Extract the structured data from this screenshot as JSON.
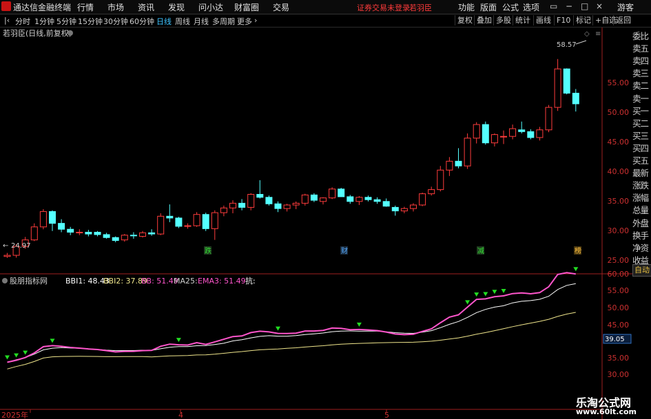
{
  "menubar": {
    "app_name": "通达信金融终端",
    "menus": [
      "行情",
      "市场",
      "资讯",
      "发现",
      "问小达",
      "财富圈",
      "交易"
    ],
    "notice": "证券交易未登录",
    "stock_name": "若羽臣",
    "right_menus": [
      "功能",
      "版面",
      "公式",
      "选项"
    ],
    "guest": "游客"
  },
  "periodbar": {
    "periods": [
      "分时",
      "1分钟",
      "5分钟",
      "15分钟",
      "30分钟",
      "60分钟",
      "日线",
      "周线",
      "月线",
      "多周期",
      "更多"
    ],
    "active": "日线",
    "tools": [
      "复权",
      "叠加",
      "多股",
      "统计",
      "画线",
      "F10",
      "标记",
      "+自选",
      "返回"
    ]
  },
  "main_chart": {
    "title": "若羽臣(日线,前复权)",
    "high_label": "58.57",
    "low_label": "24.97",
    "y_ticks": [
      "55.00",
      "50.00",
      "45.00",
      "40.00",
      "35.00",
      "30.00",
      "25.00"
    ],
    "markers": [
      "跌",
      "财",
      "减",
      "榜"
    ]
  },
  "indicator": {
    "name": "股朋指标网",
    "items": [
      {
        "label": "BBI1: 48.43",
        "color": "#ffffff"
      },
      {
        "label": "BBI2: 37.89",
        "color": "#f0e68c"
      },
      {
        "label": "BB: 51.49",
        "color": "#ff55cc"
      },
      {
        "label": "MA25:",
        "color": "#cfcfcf"
      },
      {
        "label": "EMA3: 51.49",
        "color": "#ff55cc"
      },
      {
        "label": "抗:",
        "color": "#ffffff"
      }
    ],
    "y_ticks": [
      "60.00",
      "55.00",
      "50.00",
      "45.00",
      "35.00",
      "30.00"
    ],
    "current_value": "39.05"
  },
  "x_axis": [
    "2025年",
    "4",
    "5"
  ],
  "right_panel": [
    "委比",
    "卖五",
    "卖四",
    "卖三",
    "卖二",
    "卖一",
    "买一",
    "买二",
    "买三",
    "买四",
    "买五",
    "最新",
    "涨跌",
    "涨幅",
    "总量",
    "外盘",
    "换手",
    "净资",
    "收益"
  ],
  "auto_button": "自动",
  "watermark": {
    "line1": "乐淘公式网",
    "line2": "www.60lt.com"
  },
  "colors": {
    "up": "#ff3c3c",
    "down": "#54ffff",
    "bb": "#ff55cc",
    "bbi1": "#ffffff",
    "bbi2": "#f0e68c",
    "arrow": "#22dd22"
  },
  "chart_data": {
    "type": "candlestick",
    "candles": [
      [
        25.2,
        25.8,
        24.97,
        25.4
      ],
      [
        25.4,
        27.3,
        25.0,
        26.9
      ],
      [
        26.9,
        28.5,
        26.5,
        28.0
      ],
      [
        28.0,
        30.8,
        27.8,
        30.2
      ],
      [
        30.2,
        33.2,
        29.8,
        32.8
      ],
      [
        32.8,
        33.0,
        29.5,
        30.8
      ],
      [
        30.8,
        31.5,
        29.3,
        29.8
      ],
      [
        29.8,
        30.2,
        28.8,
        29.3
      ],
      [
        29.3,
        29.8,
        28.8,
        29.3
      ],
      [
        29.3,
        29.7,
        28.6,
        29.0
      ],
      [
        29.3,
        29.5,
        28.6,
        28.9
      ],
      [
        28.9,
        29.2,
        28.2,
        28.4
      ],
      [
        28.4,
        28.6,
        27.6,
        27.9
      ],
      [
        28.0,
        29.0,
        27.7,
        28.8
      ],
      [
        28.8,
        29.3,
        28.2,
        28.7
      ],
      [
        28.6,
        29.5,
        28.4,
        29.2
      ],
      [
        29.2,
        29.8,
        28.7,
        29.0
      ],
      [
        29.0,
        32.5,
        28.8,
        32.0
      ],
      [
        32.0,
        34.0,
        31.0,
        31.7
      ],
      [
        31.7,
        31.9,
        30.0,
        30.3
      ],
      [
        30.3,
        30.8,
        29.9,
        30.4
      ],
      [
        30.4,
        32.7,
        30.2,
        32.3
      ],
      [
        32.3,
        32.6,
        29.5,
        29.9
      ],
      [
        29.9,
        33.0,
        28.0,
        32.6
      ],
      [
        32.6,
        33.8,
        32.0,
        33.4
      ],
      [
        33.4,
        34.7,
        32.5,
        34.2
      ],
      [
        34.2,
        34.9,
        33.0,
        33.5
      ],
      [
        33.5,
        35.9,
        33.0,
        35.7
      ],
      [
        35.7,
        38.1,
        35.0,
        35.2
      ],
      [
        35.2,
        35.5,
        33.8,
        34.1
      ],
      [
        34.1,
        34.5,
        32.7,
        33.3
      ],
      [
        33.3,
        34.1,
        32.8,
        33.9
      ],
      [
        33.9,
        34.5,
        33.2,
        34.2
      ],
      [
        34.2,
        35.8,
        33.8,
        35.6
      ],
      [
        35.6,
        35.9,
        34.4,
        34.7
      ],
      [
        34.5,
        35.2,
        34.0,
        35.1
      ],
      [
        35.1,
        36.9,
        34.9,
        36.6
      ],
      [
        36.6,
        36.8,
        35.3,
        35.3
      ],
      [
        35.3,
        35.6,
        34.1,
        34.5
      ],
      [
        34.5,
        35.4,
        33.9,
        35.2
      ],
      [
        35.2,
        35.5,
        34.5,
        34.8
      ],
      [
        34.8,
        35.2,
        34.1,
        34.5
      ],
      [
        34.5,
        35.0,
        33.6,
        33.7
      ],
      [
        33.5,
        33.8,
        32.1,
        32.9
      ],
      [
        32.9,
        33.6,
        32.5,
        33.3
      ],
      [
        33.3,
        34.2,
        32.8,
        33.9
      ],
      [
        33.9,
        36.0,
        33.7,
        35.8
      ],
      [
        35.8,
        37.0,
        35.5,
        36.5
      ],
      [
        36.5,
        40.5,
        36.2,
        39.8
      ],
      [
        39.8,
        42.0,
        38.8,
        41.3
      ],
      [
        41.3,
        43.5,
        40.1,
        40.5
      ],
      [
        40.5,
        46.0,
        40.0,
        45.2
      ],
      [
        45.2,
        47.9,
        44.3,
        47.5
      ],
      [
        47.5,
        48.0,
        44.1,
        44.4
      ],
      [
        44.4,
        46.0,
        43.8,
        45.8
      ],
      [
        45.5,
        46.5,
        44.2,
        45.5
      ],
      [
        45.5,
        47.5,
        45.0,
        46.8
      ],
      [
        46.6,
        48.0,
        46.0,
        46.3
      ],
      [
        46.3,
        46.7,
        45.0,
        45.3
      ],
      [
        45.3,
        47.1,
        44.8,
        46.6
      ],
      [
        46.6,
        50.8,
        46.2,
        50.4
      ],
      [
        50.4,
        58.57,
        49.8,
        56.9
      ],
      [
        56.9,
        57.0,
        52.6,
        52.8
      ],
      [
        52.8,
        53.5,
        49.7,
        51.0
      ]
    ]
  }
}
